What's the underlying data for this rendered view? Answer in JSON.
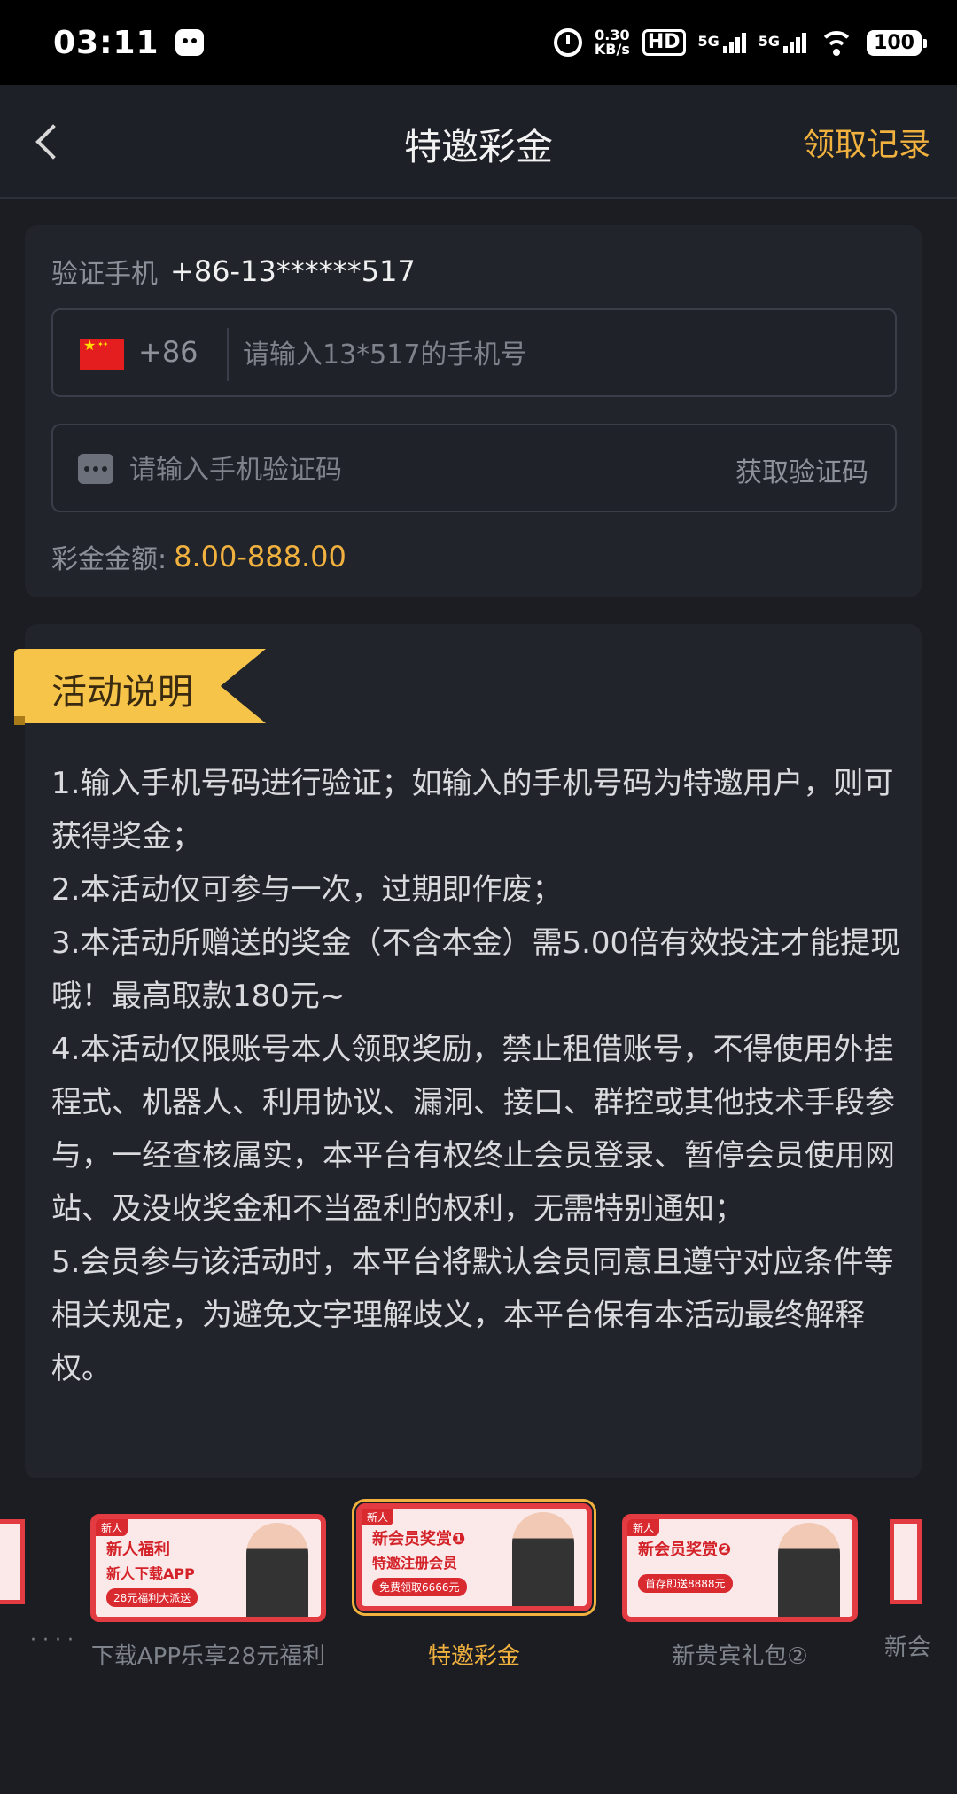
{
  "status_bar": {
    "time": "03:11",
    "speed_value": "0.30",
    "speed_unit": "KB/s",
    "hd": "HD",
    "net1": "5G",
    "net2": "5G",
    "battery": "100"
  },
  "header": {
    "title": "特邀彩金",
    "records_link": "领取记录"
  },
  "verify": {
    "label": "验证手机",
    "phone": "+86-13******517",
    "country_code": "+86",
    "phone_placeholder": "请输入13*517的手机号",
    "code_placeholder": "请输入手机验证码",
    "get_code": "获取验证码",
    "amount_label": "彩金金额:",
    "amount_value": "8.00-888.00"
  },
  "activity": {
    "heading": "活动说明",
    "rules": [
      "1.输入手机号码进行验证；如输入的手机号码为特邀用户，则可获得奖金；",
      "2.本活动仅可参与一次，过期即作废；",
      "3.本活动所赠送的奖金（不含本金）需5.00倍有效投注才能提现哦！最高取款180元~",
      "4.本活动仅限账号本人领取奖励，禁止租借账号，不得使用外挂程式、机器人、利用协议、漏洞、接口、群控或其他技术手段参与，一经查核属实，本平台有权终止会员登录、暂停会员使用网站、及没收奖金和不当盈利的权利，无需特别通知；",
      "5.会员参与该活动时，本平台将默认会员同意且遵守对应条件等相关规定，为避免文字理解歧义，本平台保有本活动最终解释权。"
    ]
  },
  "carousel": {
    "left_caption": "· · · ·",
    "right_caption": "新会",
    "items": [
      {
        "tag": "新人",
        "head": "新人福利",
        "sub": "新人下载APP",
        "pill": "28元福利大派送",
        "caption": "下载APP乐享28元福利"
      },
      {
        "tag": "新人",
        "head": "新会员奖赏❶",
        "sub": "特邀注册会员",
        "pill": "免费领取6666元",
        "caption": "特邀彩金"
      },
      {
        "tag": "新人",
        "head": "新会员奖赏❷",
        "sub": "",
        "pill": "首存即送8888元",
        "caption": "新贵宾礼包②"
      }
    ]
  },
  "colors": {
    "accent": "#f0b13f",
    "background": "#1b1d22",
    "card": "#21242b",
    "ribbon": "#f7c44a",
    "banner_red": "#e23b42"
  },
  "icons": [
    "back-arrow-icon",
    "china-flag-icon",
    "message-icon",
    "alarm-icon",
    "wifi-icon",
    "battery-icon"
  ]
}
